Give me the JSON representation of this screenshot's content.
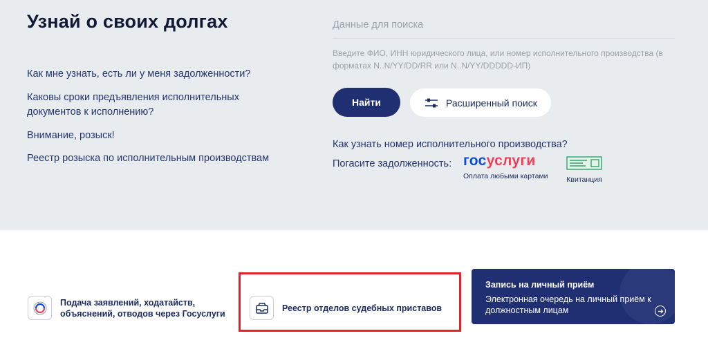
{
  "hero": {
    "title": "Узнай о своих долгах",
    "faq": [
      "Как мне узнать, есть ли у меня задолженности?",
      "Каковы сроки предъявления исполнительных документов к исполнению?",
      "Внимание, розыск!",
      "Реестр розыска по исполнительным производствам"
    ]
  },
  "search": {
    "placeholder": "Данные для поиска",
    "hint": "Введите ФИО, ИНН юридического лица, или номер исполнительного производства (в форматах N..N/YY/DD/RR или N..N/YY/DDDDD-ИП)",
    "find_label": "Найти",
    "advanced_label": "Расширенный поиск",
    "how_link": "Как узнать номер исполнительного производства?",
    "pay_label": "Погасите задолженность:",
    "gosuslugi_blue": "гос",
    "gosuslugi_red": "услуги",
    "gosuslugi_caption": "Оплата любыми картами",
    "kvit_caption": "Квитанция"
  },
  "cards": {
    "applications": "Подача заявлений, ходатайств, объяснений, отводов через Госуслуги",
    "registry": "Реестр отделов судебных приставов",
    "appointment_title": "Запись на личный приём",
    "appointment_desc": "Электронная очередь на личный приём к должностным лицам"
  },
  "colors": {
    "brand_navy": "#1f2f72",
    "hero_bg": "#e9ecef",
    "highlight": "#e1242b",
    "gos_blue": "#0d4cd3",
    "gos_red": "#ee3f58"
  }
}
